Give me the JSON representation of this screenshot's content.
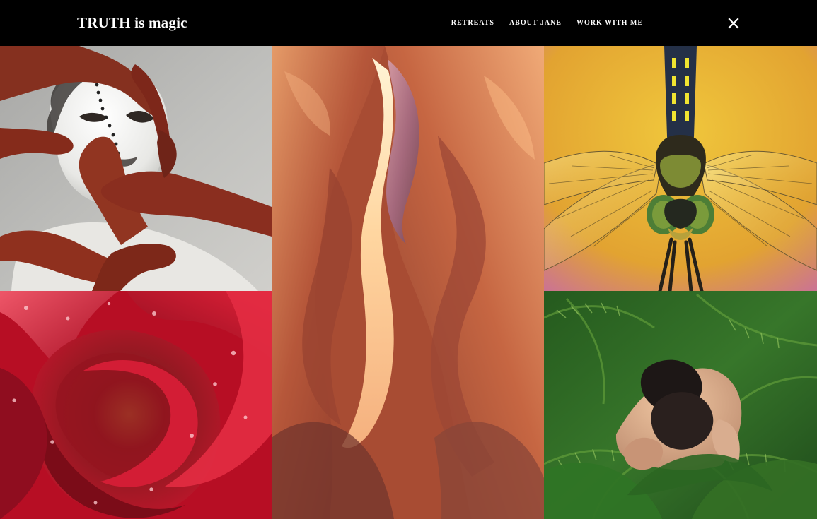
{
  "brand": {
    "title": "TRUTH is magic"
  },
  "nav": {
    "items": [
      {
        "label": "RETREATS"
      },
      {
        "label": "ABOUT JANE"
      },
      {
        "label": "WORK WITH ME"
      }
    ],
    "close_icon": "close-icon"
  },
  "gallery": {
    "tiles": [
      {
        "subject": "white-painted-face-with-red-hands",
        "icon": "image"
      },
      {
        "subject": "slot-canyon-rock-walls",
        "icon": "image"
      },
      {
        "subject": "dragonfly-on-yellow",
        "icon": "image"
      },
      {
        "subject": "red-rose-with-water-drops",
        "icon": "image"
      },
      {
        "subject": "embracing-figures-in-ferns",
        "icon": "image"
      }
    ]
  },
  "colors": {
    "header_bg": "#000000",
    "header_text": "#ffffff",
    "face_bg": "#b8b8b5",
    "hand_red": "#8b2f1f",
    "canyon": "#c46a3c",
    "dragonfly_bg": "#e7b935",
    "rose": "#c70f25",
    "fern": "#2f6b24"
  }
}
